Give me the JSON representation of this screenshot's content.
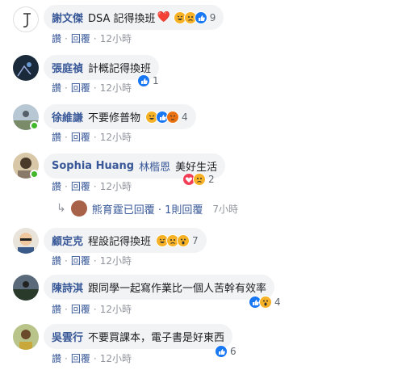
{
  "comments": [
    {
      "name": "謝文傑",
      "text": "DSA 記得換班",
      "emoji": "❤️",
      "reactions": [
        "haha",
        "sad",
        "like"
      ],
      "reaction_count": "9",
      "actions": {
        "reply_a": "讚",
        "reply_b": "回覆",
        "time": "12小時"
      }
    },
    {
      "name": "張庭禎",
      "text": "計概記得換班",
      "reactions": [
        "like"
      ],
      "reaction_count": "1",
      "actions": {
        "reply_a": "讚",
        "reply_b": "回覆",
        "time": "12小時"
      }
    },
    {
      "name": "徐維謙",
      "text": "不要修普物",
      "reactions": [
        "haha",
        "like",
        "angry"
      ],
      "reaction_count": "4",
      "actions": {
        "reply_a": "讚",
        "reply_b": "回覆",
        "time": "12小時"
      }
    },
    {
      "name": "Sophia Huang",
      "name_alt": "林楷恩",
      "text": "美好生活",
      "reactions": [
        "love",
        "sad"
      ],
      "reaction_count": "2",
      "actions": {
        "reply_a": "讚",
        "reply_b": "回覆",
        "time": "12小時"
      },
      "reply": {
        "text": "熊育霆已回覆 · 1則回覆",
        "time": "7小時"
      }
    },
    {
      "name": "顧定克",
      "text": "程設記得換班",
      "reactions": [
        "haha",
        "sad",
        "wow"
      ],
      "reaction_count": "7",
      "actions": {
        "reply_a": "讚",
        "reply_b": "回覆",
        "time": "12小時"
      }
    },
    {
      "name": "陳詩淇",
      "text": "跟同學一起寫作業比一個人苦幹有效率",
      "reactions": [
        "like",
        "wow"
      ],
      "reaction_count": "4",
      "actions": {
        "reply_a": "讚",
        "reply_b": "回覆",
        "time": "12小時"
      }
    },
    {
      "name": "吳雲行",
      "text": "不要買課本，電子書是好東西",
      "reactions": [
        "like"
      ],
      "reaction_count": "6",
      "actions": {
        "reply_a": "讚",
        "reply_b": "回覆",
        "time": "12小時"
      }
    }
  ],
  "colors": {
    "link": "#385898",
    "bubble": "#f2f3f5",
    "meta": "#90949c",
    "online": "#42b72a"
  }
}
